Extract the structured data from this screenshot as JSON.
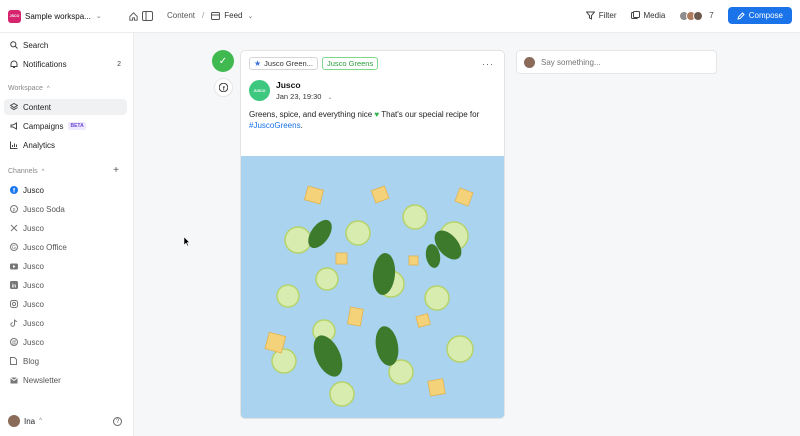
{
  "workspace": {
    "logo_text": "JSCO",
    "name": "Sample workspa..."
  },
  "breadcrumb": {
    "section": "Content",
    "separator": "/",
    "view": "Feed"
  },
  "toolbar": {
    "filter_label": "Filter",
    "media_label": "Media",
    "collaborator_count": "7",
    "compose_label": "Compose"
  },
  "sidebar": {
    "search_label": "Search",
    "notifications_label": "Notifications",
    "notifications_count": "2",
    "workspace_header": "Workspace",
    "workspace_items": [
      {
        "label": "Content",
        "icon": "layers-icon"
      },
      {
        "label": "Campaigns",
        "icon": "megaphone-icon",
        "badge": "BETA"
      },
      {
        "label": "Analytics",
        "icon": "bar-chart-icon"
      }
    ],
    "channels_header": "Channels",
    "channels": [
      {
        "label": "Jusco",
        "icon": "facebook-icon"
      },
      {
        "label": "Jusco Soda",
        "icon": "pinterest-icon"
      },
      {
        "label": "Jusco",
        "icon": "x-icon"
      },
      {
        "label": "Jusco Office",
        "icon": "google-business-icon"
      },
      {
        "label": "Jusco",
        "icon": "youtube-icon"
      },
      {
        "label": "Jusco",
        "icon": "linkedin-icon"
      },
      {
        "label": "Jusco",
        "icon": "instagram-icon"
      },
      {
        "label": "Jusco",
        "icon": "tiktok-icon"
      },
      {
        "label": "Jusco",
        "icon": "threads-icon"
      },
      {
        "label": "Blog",
        "icon": "document-icon"
      },
      {
        "label": "Newsletter",
        "icon": "mail-icon"
      }
    ],
    "user_name": "Ina"
  },
  "post": {
    "tag_campaign": "Jusco Green...",
    "tag_label": "Jusco Greens",
    "account_avatar_text": "JUSCO",
    "account_name": "Jusco",
    "date": "Jan 23, 19:30",
    "text": "Greens, spice, and everything nice",
    "text_suffix": "That's our special recipe for",
    "hashtag": "#JuscoGreens",
    "hashtag_end": "."
  },
  "comment": {
    "placeholder": "Say something..."
  },
  "colors": {
    "accent": "#1a73e8",
    "approved": "#3fb950",
    "image_background": "#a9d3ee",
    "brand": "#d6246e"
  }
}
